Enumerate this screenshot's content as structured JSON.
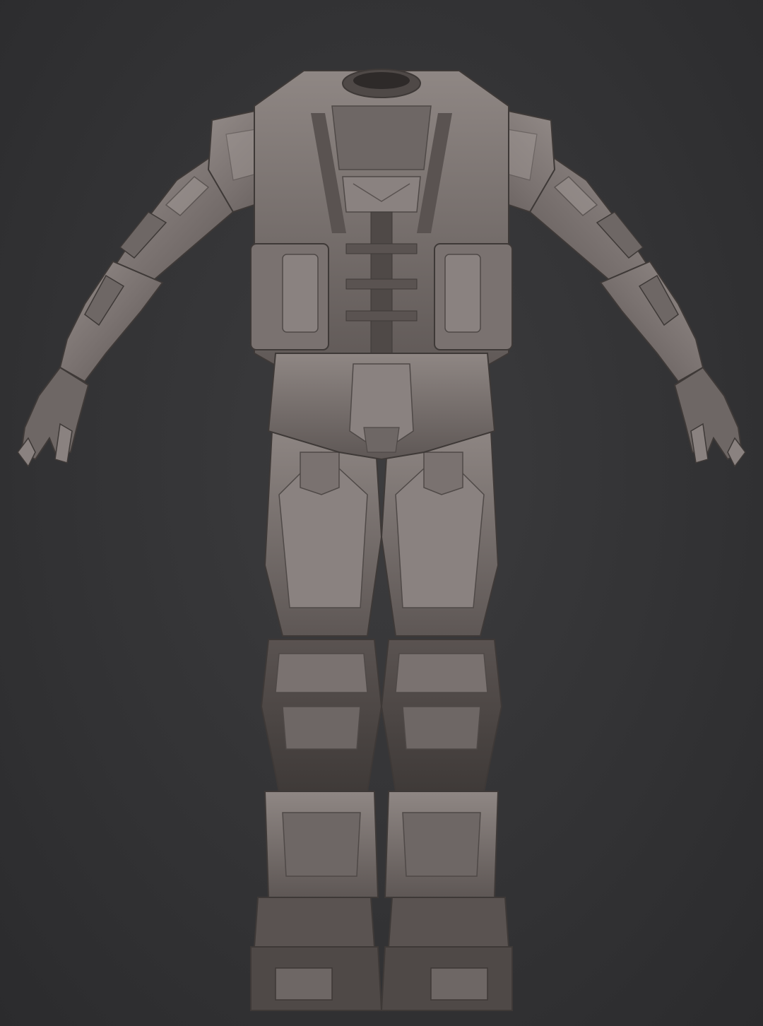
{
  "colors": {
    "background": "#353537",
    "armor_light": "#8a8280",
    "armor_mid": "#6e6765",
    "armor_dark": "#4f4947",
    "armor_shadow": "#3e3937",
    "highlight": "#a39b98"
  }
}
